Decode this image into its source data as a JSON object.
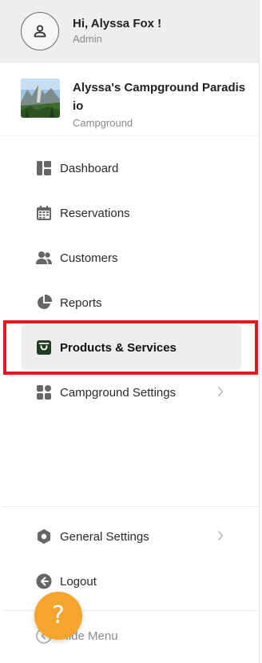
{
  "user": {
    "greeting": "Hi, Alyssa Fox !",
    "role": "Admin"
  },
  "campground": {
    "name": "Alyssa's Campground Paradisio",
    "type": "Campground"
  },
  "nav": {
    "dashboard": "Dashboard",
    "reservations": "Reservations",
    "customers": "Customers",
    "reports": "Reports",
    "products": "Products & Services",
    "campground_settings": "Campground Settings"
  },
  "footer_nav": {
    "general_settings": "General Settings",
    "logout": "Logout",
    "hide_menu": "Hide Menu"
  },
  "help": {
    "glyph": "?"
  },
  "icons": {
    "user": "user-icon",
    "dashboard": "dashboard-icon",
    "reservations": "calendar-icon",
    "customers": "users-icon",
    "reports": "pie-chart-icon",
    "products": "shopping-bag-icon",
    "campground_settings": "apps-icon",
    "general_settings": "gear-icon",
    "logout": "logout-icon",
    "hide_menu": "collapse-icon"
  },
  "colors": {
    "highlight": "#e0191b",
    "help_button": "#f5a52d",
    "active_bg": "#eeeeee"
  }
}
